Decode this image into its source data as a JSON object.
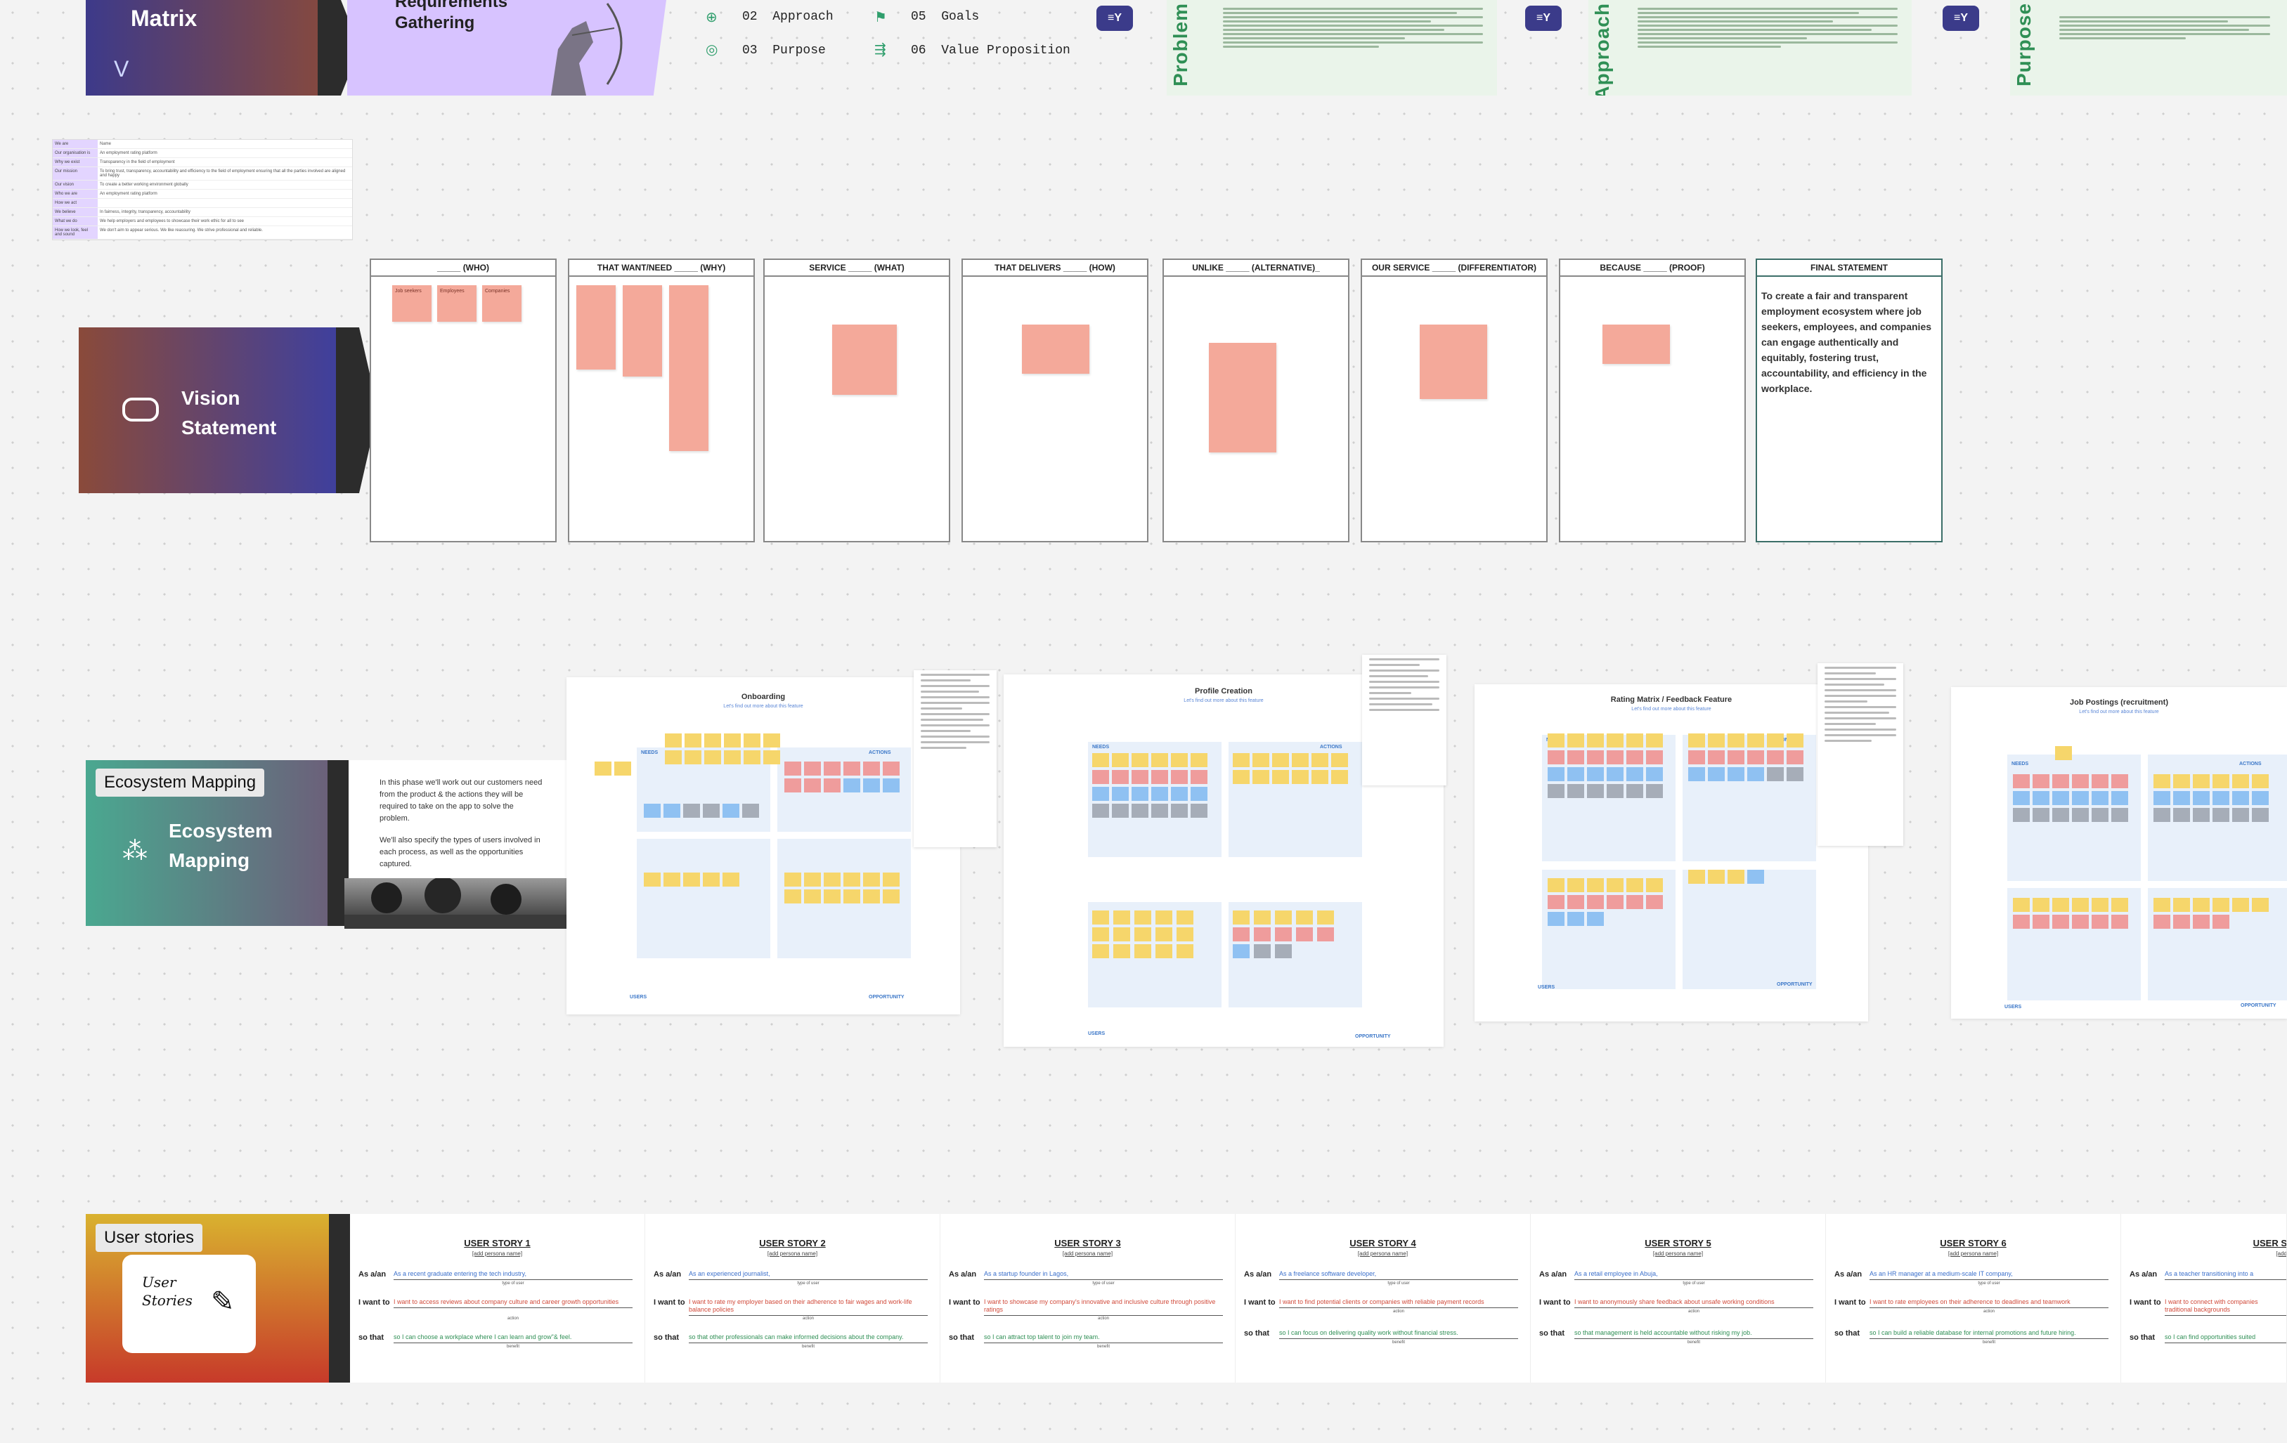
{
  "top": {
    "matrix_title": "Matrix",
    "requirements_title": "Requirements Gathering",
    "nav_items": [
      {
        "num": "02",
        "label": "Approach"
      },
      {
        "num": "03",
        "label": "Purpose"
      },
      {
        "num": "05",
        "label": "Goals"
      },
      {
        "num": "06",
        "label": "Value Proposition"
      }
    ],
    "vertical_labels": [
      "Problem",
      "Approach",
      "Purpose"
    ]
  },
  "grid_table": {
    "rows": [
      {
        "k": "We are",
        "v": "Name"
      },
      {
        "k": "Our organisation is",
        "v": "An employment rating platform"
      },
      {
        "k": "Why we exist",
        "v": "Transparency in the field of employment"
      },
      {
        "k": "Our mission",
        "v": "To bring trust, transparency, accountability and efficiency to the field of employment ensuring that all the parties involved are aligned and happy"
      },
      {
        "k": "Our vision",
        "v": "To create a better working environment globally"
      },
      {
        "k": "Who we are",
        "v": "An employment rating platform"
      },
      {
        "k": "How we act",
        "v": ""
      },
      {
        "k": "We believe",
        "v": "In fairness, integrity, transparency, accountability"
      },
      {
        "k": "What we do",
        "v": "We help employers and employees to showcase their work ethic for all to see"
      },
      {
        "k": "How we look, feel and sound",
        "v": "We don't aim to appear serious. We like reassuring. We strive professional and reliable."
      }
    ]
  },
  "vision": {
    "title": "Vision Statement",
    "columns": [
      {
        "head": "_____ (WHO)"
      },
      {
        "head": "THAT WANT/NEED _____ (WHY)"
      },
      {
        "head": "SERVICE _____ (WHAT)"
      },
      {
        "head": "THAT DELIVERS _____ (HOW)"
      },
      {
        "head": "UNLIKE _____ (ALTERNATIVE)_"
      },
      {
        "head": "OUR SERVICE _____ (DIFFERENTIATOR)"
      },
      {
        "head": "BECAUSE _____ (PROOF)"
      },
      {
        "head": "FINAL STATEMENT"
      }
    ],
    "who_stickies": [
      "Job seekers",
      "Employees",
      "Companies"
    ],
    "final_statement": "To create a fair and transparent employment ecosystem where job seekers, employees, and companies can engage authentically and equitably, fostering trust, accountability, and efficiency in the workplace."
  },
  "ecosystem": {
    "chip": "Ecosystem Mapping",
    "title": "Ecosystem Mapping",
    "paragraph1": "In this phase we'll work out our customers need from the product & the actions they will be required to take on the app to solve the problem.",
    "paragraph2": "We'll also specify the types of users involved in each process, as well as the opportunities captured.",
    "boards": [
      {
        "title": "Onboarding",
        "sub": "Let's find out more about this feature"
      },
      {
        "title": "Profile Creation",
        "sub": "Let's find out more about this feature"
      },
      {
        "title": "Rating Matrix / Feedback Feature",
        "sub": "Let's find out more about this feature"
      },
      {
        "title": "Job Postings (recruitment)",
        "sub": "Let's find out more about this feature"
      }
    ],
    "zone_labels": {
      "needs": "NEEDS",
      "actions": "ACTIONS",
      "users": "USERS",
      "opportunity": "OPPORTUNITY"
    }
  },
  "stories": {
    "chip": "User stories",
    "card_text": "User Stories",
    "labels": {
      "as": "As a/an",
      "want": "I want to",
      "so": "so that"
    },
    "hints": {
      "as": "type of user",
      "want": "action",
      "so": "benefit"
    },
    "items": [
      {
        "title": "USER STORY 1",
        "sub": "[add persona name]",
        "as": "As a recent graduate entering the tech industry,",
        "want": "I want to access reviews about company culture and career growth opportunities",
        "so": "so I can choose a workplace where I can learn and grow\"& feel."
      },
      {
        "title": "USER STORY 2",
        "sub": "[add persona name]",
        "as": "As an experienced journalist,",
        "want": "I want to rate my employer based on their adherence to fair wages and work-life balance policies",
        "so": "so that other professionals can make informed decisions about the company."
      },
      {
        "title": "USER STORY 3",
        "sub": "[add persona name]",
        "as": "As a startup founder in Lagos,",
        "want": "I want to showcase my company's innovative and inclusive culture through positive ratings",
        "so": "so I can attract top talent to join my team."
      },
      {
        "title": "USER STORY 4",
        "sub": "[add persona name]",
        "as": "As a freelance software developer,",
        "want": "I want to find potential clients or companies with reliable payment records",
        "so": "so I can focus on delivering quality work without financial stress."
      },
      {
        "title": "USER STORY 5",
        "sub": "[add persona name]",
        "as": "As a retail employee in Abuja,",
        "want": "I want to anonymously share feedback about unsafe working conditions",
        "so": "so that management is held accountable without risking my job."
      },
      {
        "title": "USER STORY 6",
        "sub": "[add persona name]",
        "as": "As an HR manager at a medium-scale IT company,",
        "want": "I want to rate employees on their adherence to deadlines and teamwork",
        "so": "so I can build a reliable database for internal promotions and future hiring."
      },
      {
        "title": "USER S",
        "sub": "[add",
        "as": "As a teacher transitioning into a",
        "want": "I want to connect with companies traditional backgrounds",
        "so": "so I can find opportunities suited"
      }
    ]
  },
  "colors": {
    "vision_gradient": [
      "#8a4a3a",
      "#3a3fa3"
    ],
    "ecosystem_gradient": [
      "#4aa890",
      "#6e5a78"
    ],
    "stories_gradient": [
      "#d9b22f",
      "#c73a2a"
    ],
    "accent_green": "#2f8f55"
  }
}
